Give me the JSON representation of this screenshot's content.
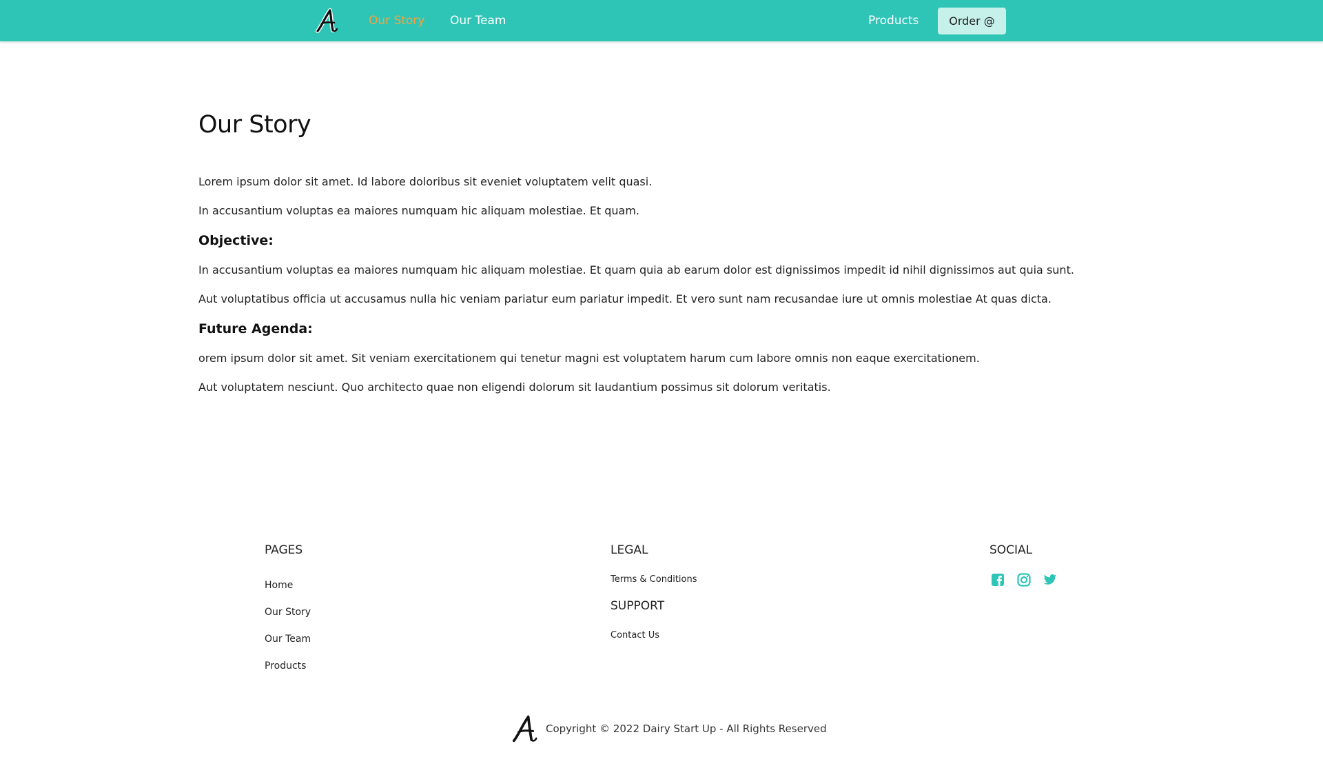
{
  "nav": {
    "logo_icon": "script-letter-a-logo",
    "links": [
      {
        "label": "Our Story"
      },
      {
        "label": "Our Team"
      }
    ],
    "products_label": "Products",
    "order_label": "Order @"
  },
  "colors": {
    "navbar_bg": "#2ec5b6",
    "active_link": "#f4a340",
    "order_button_bg": "#c6f0ea",
    "social_icon": "#2ec5b6"
  },
  "main": {
    "title": "Our Story",
    "intro": [
      "Lorem ipsum dolor sit amet. Id labore doloribus sit eveniet voluptatem velit quasi.",
      "In accusantium voluptas ea maiores numquam hic aliquam molestiae. Et quam."
    ],
    "objective": {
      "heading": "Objective:",
      "paragraphs": [
        "In accusantium voluptas ea maiores numquam hic aliquam molestiae. Et quam quia ab earum dolor est dignissimos impedit id nihil dignissimos aut quia sunt.",
        "Aut voluptatibus officia ut accusamus nulla hic veniam pariatur eum pariatur impedit. Et vero sunt nam recusandae iure ut omnis molestiae At quas dicta."
      ]
    },
    "agenda": {
      "heading": "Future Agenda:",
      "paragraphs": [
        "orem ipsum dolor sit amet. Sit veniam exercitationem qui tenetur magni est voluptatem harum cum labore omnis non eaque exercitationem.",
        "Aut voluptatem nesciunt. Quo architecto quae non eligendi dolorum sit laudantium possimus sit dolorum veritatis."
      ]
    }
  },
  "footer": {
    "pages": {
      "heading": "PAGES",
      "links": [
        "Home",
        "Our Story",
        "Our Team",
        "Products"
      ]
    },
    "legal": {
      "heading": "LEGAL",
      "links": [
        "Terms & Conditions"
      ]
    },
    "support": {
      "heading": "SUPPORT",
      "links": [
        "Contact Us"
      ]
    },
    "social": {
      "heading": "SOCIAL",
      "icons": [
        "facebook-icon",
        "instagram-icon",
        "twitter-icon"
      ]
    },
    "copyright": "Copyright © 2022 Dairy Start Up - All Rights Reserved"
  }
}
